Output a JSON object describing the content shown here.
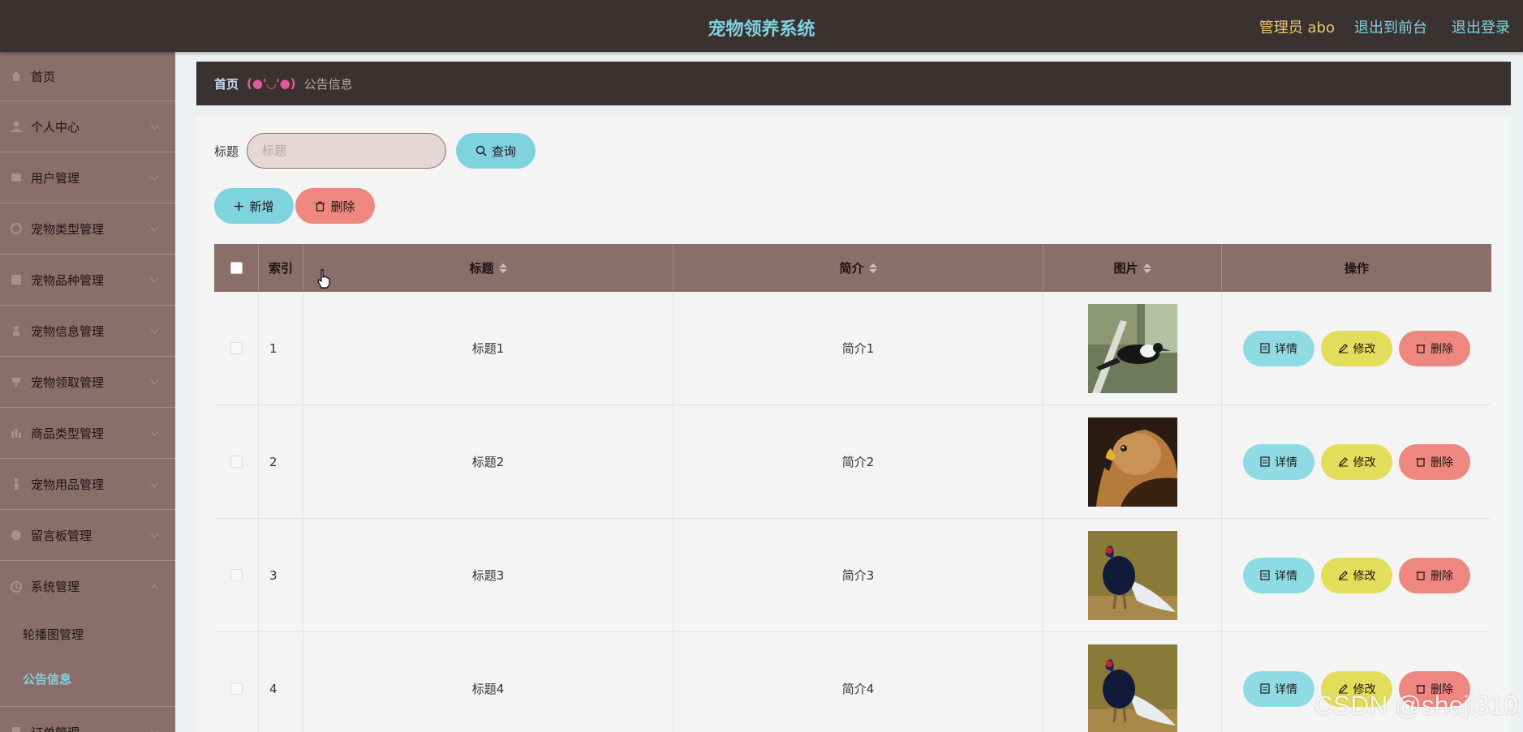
{
  "header": {
    "title": "宠物领养系统",
    "user_label": "管理员 abo",
    "front_link": "退出到前台",
    "logout_link": "退出登录"
  },
  "sidebar": {
    "items": [
      {
        "label": "首页",
        "icon": "home-icon"
      },
      {
        "label": "个人中心",
        "icon": "user-icon"
      },
      {
        "label": "用户管理",
        "icon": "users-icon"
      },
      {
        "label": "宠物类型管理",
        "icon": "category-icon"
      },
      {
        "label": "宠物品种管理",
        "icon": "breed-icon"
      },
      {
        "label": "宠物信息管理",
        "icon": "pet-info-icon"
      },
      {
        "label": "宠物领取管理",
        "icon": "adopt-icon"
      },
      {
        "label": "商品类型管理",
        "icon": "goods-type-icon"
      },
      {
        "label": "宠物用品管理",
        "icon": "supplies-icon"
      },
      {
        "label": "留言板管理",
        "icon": "message-icon"
      },
      {
        "label": "系统管理",
        "icon": "system-icon"
      }
    ],
    "submenu": [
      {
        "label": "轮播图管理"
      },
      {
        "label": "公告信息"
      }
    ],
    "after": {
      "label": "订单管理",
      "icon": "order-icon"
    }
  },
  "breadcrumb": {
    "home": "首页",
    "separator": "(●'◡'●)",
    "current": "公告信息"
  },
  "search": {
    "label": "标题",
    "placeholder": "标题",
    "button": "查询"
  },
  "actions": {
    "add": "新增",
    "delete": "删除"
  },
  "table": {
    "headers": {
      "index": "索引",
      "title": "标题",
      "intro": "简介",
      "image": "图片",
      "ops": "操作"
    },
    "rows": [
      {
        "index": "1",
        "title": "标题1",
        "intro": "简介1",
        "image": "bird-magpie"
      },
      {
        "index": "2",
        "title": "标题2",
        "intro": "简介2",
        "image": "bird-eagle"
      },
      {
        "index": "3",
        "title": "标题3",
        "intro": "简介3",
        "image": "bird-pheasant"
      },
      {
        "index": "4",
        "title": "标题4",
        "intro": "简介4",
        "image": "bird-pheasant"
      }
    ],
    "op_labels": {
      "detail": "详情",
      "edit": "修改",
      "delete": "删除"
    }
  },
  "watermark": "CSDN @sheji310",
  "colors": {
    "header_bg": "#3a3131",
    "sidebar_bg": "#8a6e6a",
    "accent_cyan": "#7fd3df",
    "accent_yellow": "#e3dd5c",
    "accent_red": "#ee877f"
  }
}
